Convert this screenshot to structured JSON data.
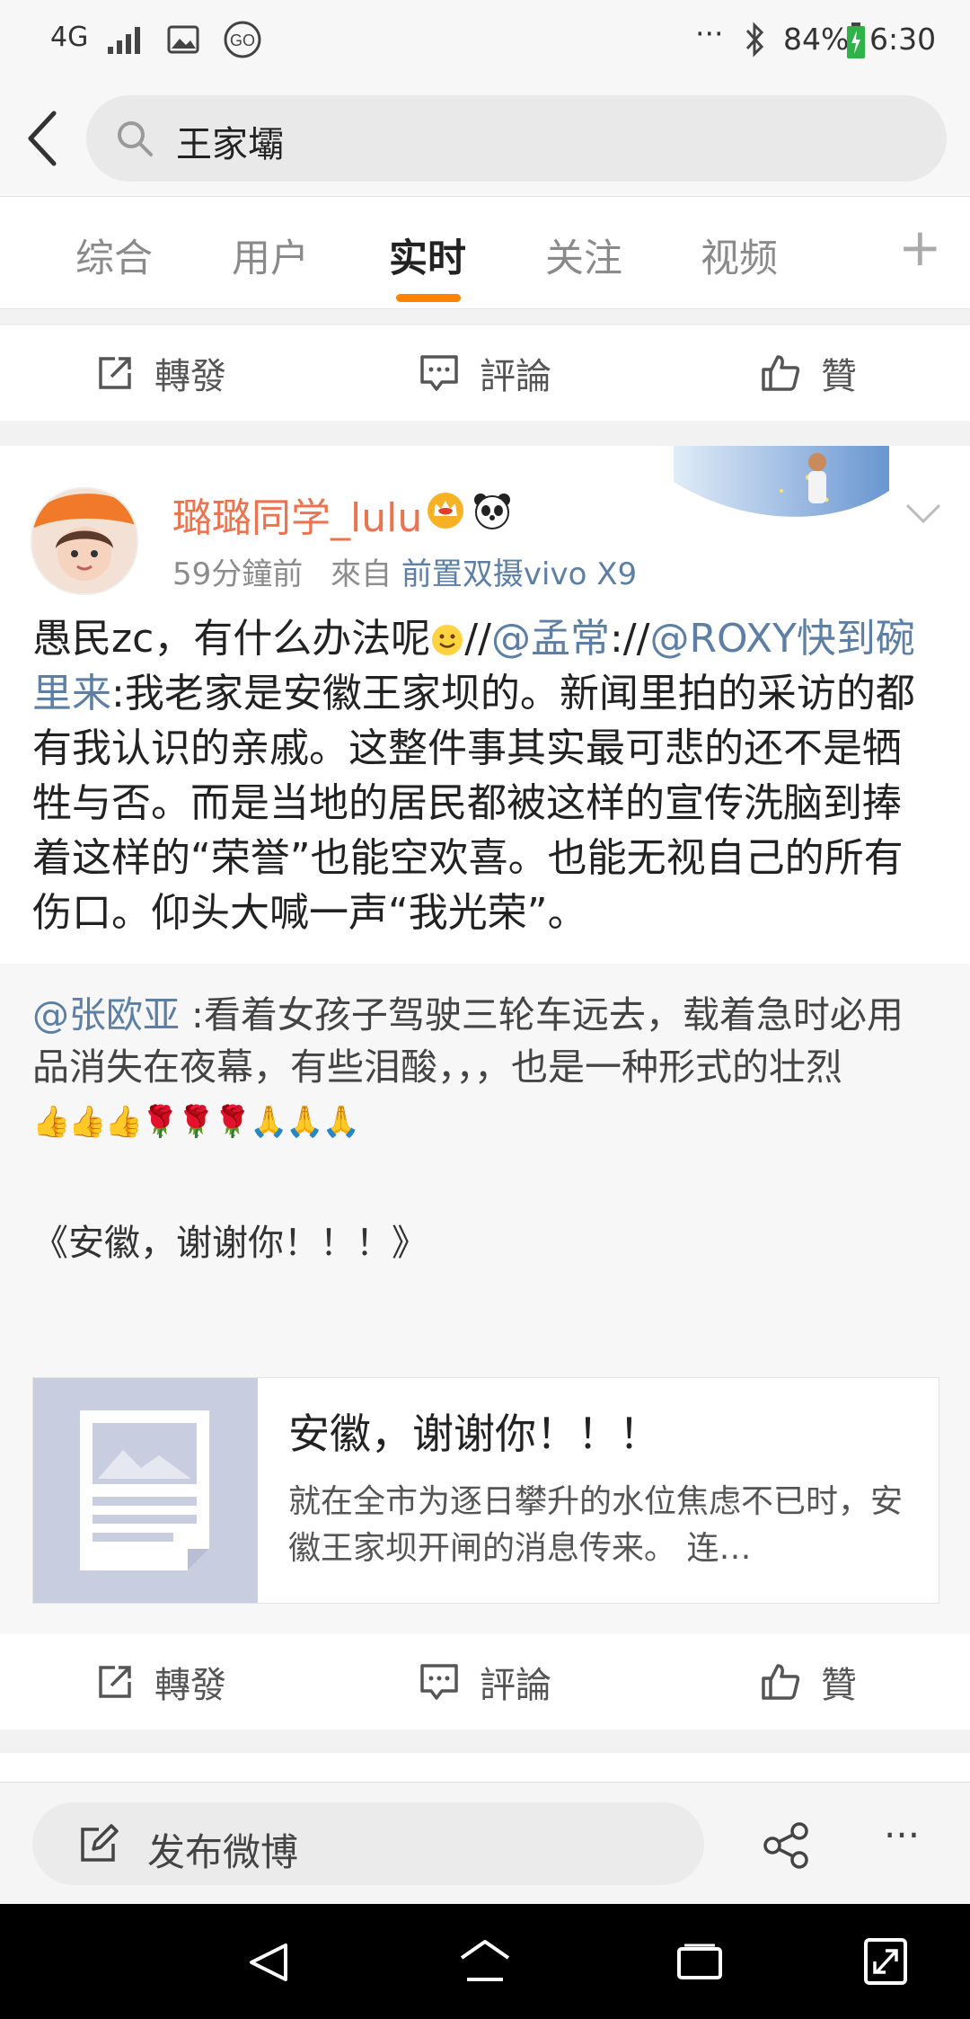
{
  "status_bar": {
    "network": "4G",
    "battery": "84%",
    "time": "6:30",
    "more": "···"
  },
  "search": {
    "query": "王家壩"
  },
  "tabs": [
    {
      "label": "综合",
      "active": false
    },
    {
      "label": "用户",
      "active": false
    },
    {
      "label": "实时",
      "active": true
    },
    {
      "label": "关注",
      "active": false
    },
    {
      "label": "视频",
      "active": false
    }
  ],
  "tabs_add": "+",
  "actions": {
    "repost": "轉發",
    "comment": "評論",
    "like": "贊"
  },
  "post": {
    "username": "璐璐同学_lulu",
    "time": "59分鐘前",
    "from": "來自",
    "source": "前置双摄vivo X9",
    "body_pre": "愚民zc，有什么办法呢",
    "mention1": "@孟常",
    "mention2": "@ROXY快到碗里来",
    "body_post": ":我老家是安徽王家坝的。新闻里拍的采访的都有我认识的亲戚。这整件事其实最可悲的还不是牺牲与否。而是当地的居民都被这样的宣传洗脑到捧着这样的“荣誉”也能空欢喜。也能无视自己的所有伤口。仰头大喊一声“我光荣”。"
  },
  "repost": {
    "author": "@张欧亚",
    "text": " :看着女孩子驾驶三轮车远去，载着急时必用品消失在夜幕，有些泪酸，，，也是一种形式的壮烈",
    "emoji_line": "👍👍👍🌹🌹🌹🙏🙏🙏",
    "book_title": "《安徽，谢谢你！！！》",
    "card": {
      "title": "安徽，谢谢你！！！",
      "desc": "就在全市为逐日攀升的水位焦虑不已时，安徽王家坝开闸的消息传来。 连…"
    }
  },
  "bottom": {
    "compose_label": "发布微博",
    "more": "···"
  },
  "colors": {
    "accent": "#ff8200",
    "link": "#5d7fa5",
    "username": "#eb7350"
  }
}
